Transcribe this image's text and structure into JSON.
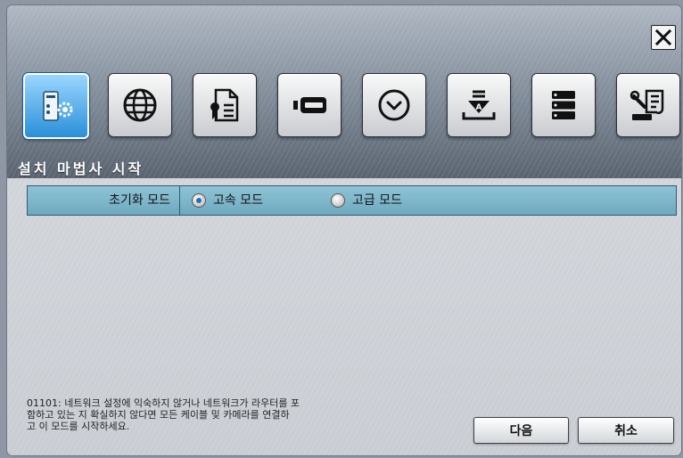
{
  "title": "설치 마법사 시작",
  "toolbar": {
    "items": [
      {
        "name": "server-setup-icon",
        "active": true
      },
      {
        "name": "globe-icon",
        "active": false
      },
      {
        "name": "certificate-icon",
        "active": false
      },
      {
        "name": "storage-device-icon",
        "active": false
      },
      {
        "name": "clock-icon",
        "active": false
      },
      {
        "name": "download-icon",
        "active": false
      },
      {
        "name": "server-rack-icon",
        "active": false
      },
      {
        "name": "tools-icon",
        "active": false
      }
    ]
  },
  "mode": {
    "label": "초기화 모드",
    "options": [
      {
        "label": "고속 모드",
        "selected": true
      },
      {
        "label": "고급 모드",
        "selected": false
      }
    ]
  },
  "help_text": "01101: 네트워크 설정에 익숙하지 않거나 네트워크가 라우터를 포\n함하고 있는 지 확실하지 않다면 모든 케이블 및 카메라를 연결하\n고 이 모드를 시작하세요.",
  "buttons": {
    "next": "다음",
    "cancel": "취소"
  },
  "colors": {
    "accent": "#2a8fd8",
    "mode_row": "#7fb7cc"
  }
}
